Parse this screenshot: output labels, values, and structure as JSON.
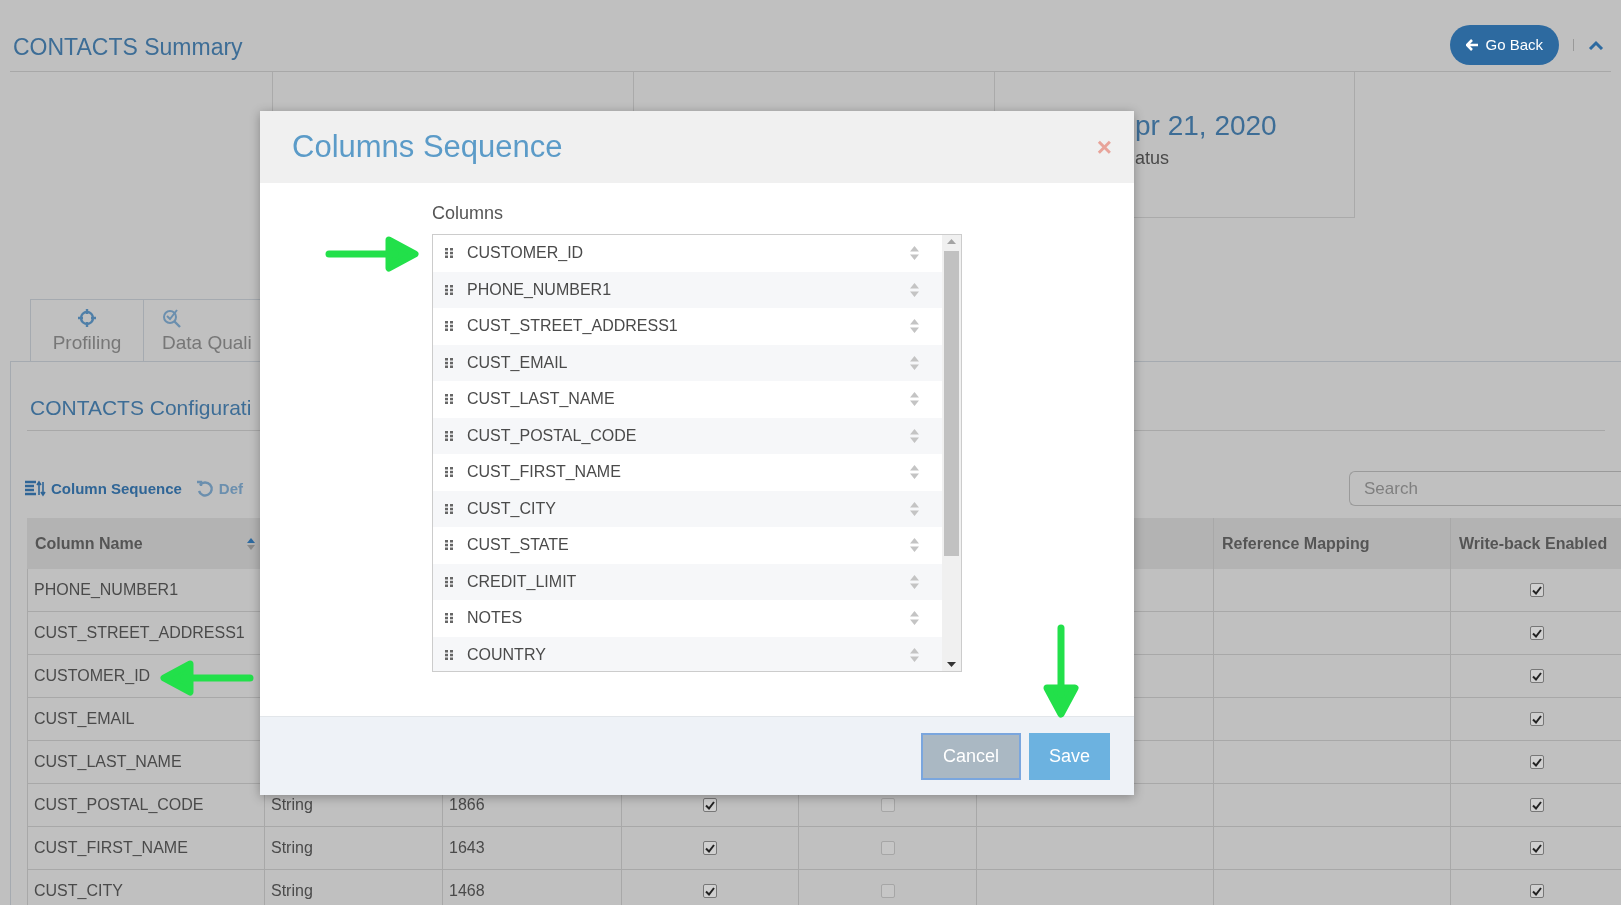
{
  "header": {
    "title": "CONTACTS Summary",
    "back_button": "Go Back"
  },
  "summary_card": {
    "date": "pr 21, 2020",
    "label": "atus"
  },
  "tabs": [
    {
      "label": "Profiling"
    },
    {
      "label": "Data Quali"
    }
  ],
  "panel": {
    "title": "CONTACTS Configurati",
    "toolbar": [
      {
        "label": "Column Sequence"
      },
      {
        "label": "Def"
      }
    ],
    "search": {
      "placeholder": "Search"
    }
  },
  "table": {
    "columns": [
      {
        "label": "Column Name"
      },
      {
        "label": "Reference Mapping"
      },
      {
        "label": "Write-back Enabled"
      }
    ],
    "rows": [
      {
        "name": "PHONE_NUMBER1",
        "write_back": true
      },
      {
        "name": "CUST_STREET_ADDRESS1",
        "write_back": true
      },
      {
        "name": "CUSTOMER_ID",
        "write_back": true
      },
      {
        "name": "CUST_EMAIL",
        "write_back": true
      },
      {
        "name": "CUST_LAST_NAME",
        "write_back": true
      },
      {
        "name": "CUST_POSTAL_CODE",
        "type": "String",
        "count": "1866",
        "flag_1": true,
        "flag_2": false,
        "write_back": true
      },
      {
        "name": "CUST_FIRST_NAME",
        "type": "String",
        "count": "1643",
        "flag_1": true,
        "flag_2": false,
        "write_back": true
      },
      {
        "name": "CUST_CITY",
        "type": "String",
        "count": "1468",
        "flag_1": true,
        "flag_2": false,
        "write_back": true
      }
    ]
  },
  "dialog": {
    "title": "Columns Sequence",
    "close": "×",
    "list_label": "Columns",
    "columns": [
      "CUSTOMER_ID",
      "PHONE_NUMBER1",
      "CUST_STREET_ADDRESS1",
      "CUST_EMAIL",
      "CUST_LAST_NAME",
      "CUST_POSTAL_CODE",
      "CUST_FIRST_NAME",
      "CUST_CITY",
      "CUST_STATE",
      "CREDIT_LIMIT",
      "NOTES",
      "COUNTRY"
    ],
    "buttons": [
      {
        "label": "Cancel",
        "kind": "secondary"
      },
      {
        "label": "Save",
        "kind": "primary"
      }
    ]
  }
}
